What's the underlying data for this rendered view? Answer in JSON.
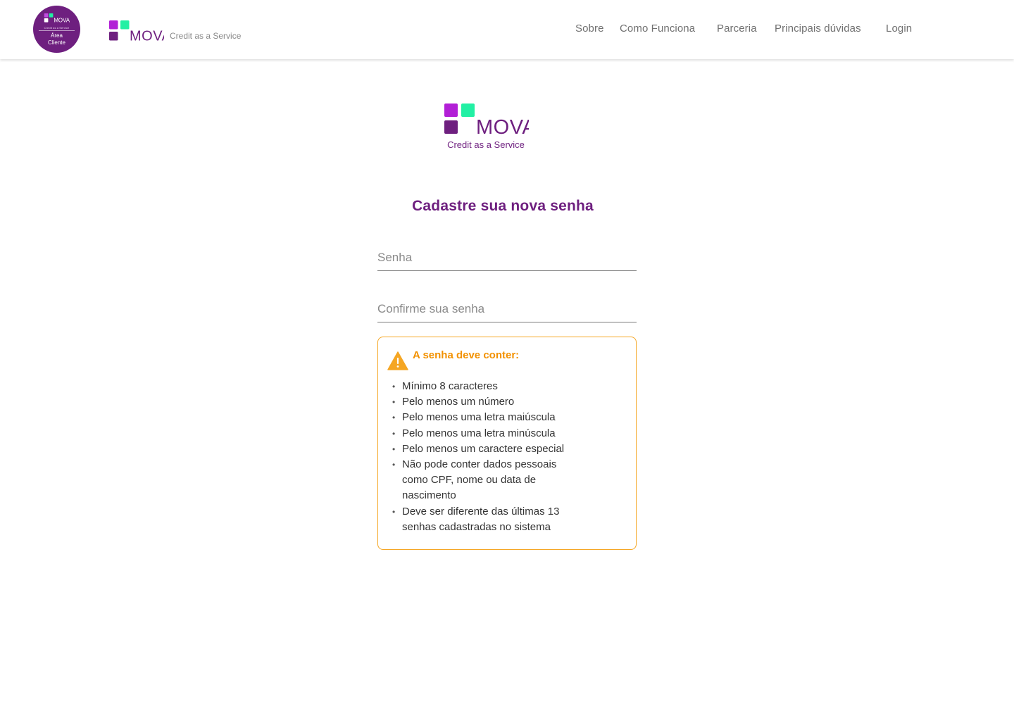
{
  "brand": {
    "name": "MOVA",
    "tagline": "Credit as a Service",
    "colors": {
      "purple": "#6e1f7f",
      "magenta": "#b21fd6",
      "green": "#22f0a4",
      "orange": "#f29100",
      "warning_border": "#f5a623"
    }
  },
  "header": {
    "badge": {
      "tagline": "Credit as a Service",
      "line1": "Área",
      "line2": "Cliente"
    },
    "nav": [
      {
        "label": "Sobre"
      },
      {
        "label": "Como Funciona"
      },
      {
        "label": "Parceria"
      },
      {
        "label": "Principais dúvidas"
      },
      {
        "label": "Login"
      }
    ]
  },
  "main": {
    "logo_tagline": "Credit as a Service",
    "title": "Cadastre sua nova senha",
    "password_field": {
      "placeholder": "Senha",
      "value": ""
    },
    "confirm_field": {
      "placeholder": "Confirme sua senha",
      "value": ""
    },
    "rules": {
      "icon": "warning-icon",
      "title": "A senha deve conter:",
      "items": [
        "Mínimo 8 caracteres",
        "Pelo menos um número",
        "Pelo menos uma letra maiúscula",
        "Pelo menos uma letra minúscula",
        "Pelo menos um caractere especial",
        "Não pode conter dados pessoais como CPF, nome ou data de nascimento",
        "Deve ser diferente das últimas 13 senhas cadastradas no sistema"
      ]
    }
  }
}
